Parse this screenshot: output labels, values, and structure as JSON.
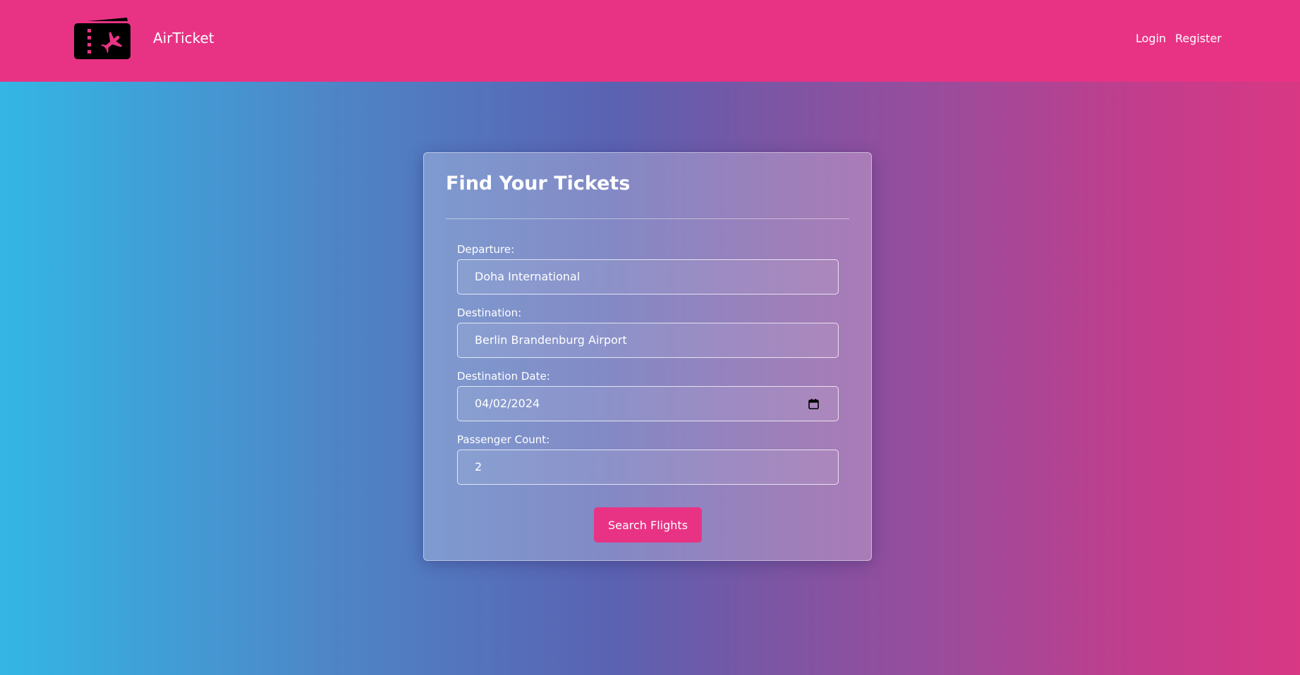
{
  "header": {
    "brand": "AirTicket",
    "logo_icon": "ticket-plane-icon",
    "nav": {
      "login": "Login",
      "register": "Register"
    },
    "background_color": "#e83385"
  },
  "search_card": {
    "title": "Find Your Tickets",
    "fields": {
      "departure": {
        "label": "Departure:",
        "value": "Doha International"
      },
      "destination": {
        "label": "Destination:",
        "value": "Berlin Brandenburg Airport"
      },
      "date": {
        "label": "Destination Date:",
        "value": "04/02/2024",
        "icon": "calendar-icon"
      },
      "passengers": {
        "label": "Passenger Count:",
        "value": "2"
      }
    },
    "search_button": "Search Flights",
    "accent_color": "#e83385"
  }
}
